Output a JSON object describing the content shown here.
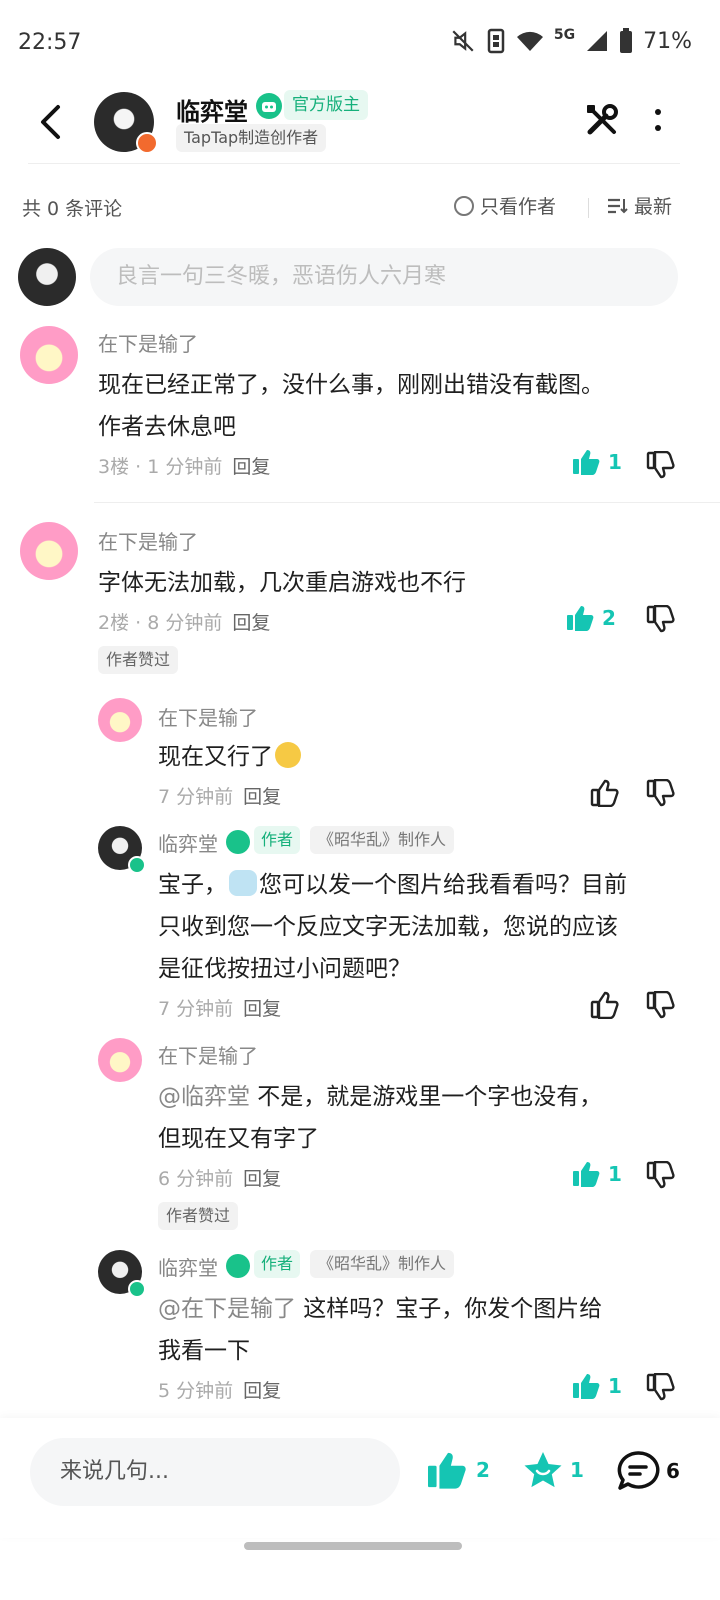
{
  "status_bar": {
    "time": "22:57",
    "network": "5G",
    "battery": "71%"
  },
  "header": {
    "name": "临弈堂",
    "official_tag": "官方版主",
    "creator_tag": "TapTap制造创作者"
  },
  "filter": {
    "comment_count": "共 0 条评论",
    "only_author": "只看作者",
    "sort": "最新"
  },
  "compose": {
    "placeholder": "良言一句三冬暖，恶语伤人六月寒"
  },
  "comments": [
    {
      "name": "在下是输了",
      "text_line1": "现在已经正常了，没什么事，刚刚出错没有截图。",
      "text_line2": "作者去休息吧",
      "meta": "3楼 · 1 分钟前",
      "reply": "回复",
      "likes": "1"
    },
    {
      "name": "在下是输了",
      "text_line1": "字体无法加载，几次重启游戏也不行",
      "meta": "2楼 · 8 分钟前",
      "reply": "回复",
      "likes": "2",
      "tag": "作者赞过"
    }
  ],
  "replies": [
    {
      "name": "在下是输了",
      "text": "现在又行了",
      "meta": "7 分钟前",
      "reply": "回复"
    },
    {
      "name": "临弈堂",
      "author_tag": "作者",
      "maker_tag": "《昭华乱》制作人",
      "text_line1a": "宝子，",
      "text_line1b": "您可以发一个图片给我看看吗？目前",
      "text_line2": "只收到您一个反应文字无法加载，您说的应该",
      "text_line3": "是征伐按扭过小问题吧？",
      "meta": "7 分钟前",
      "reply": "回复"
    },
    {
      "name": "在下是输了",
      "mention": "@临弈堂",
      "text_line1": " 不是，就是游戏里一个字也没有，",
      "text_line2": "但现在又有字了",
      "meta": "6 分钟前",
      "reply": "回复",
      "likes": "1",
      "tag": "作者赞过"
    },
    {
      "name": "临弈堂",
      "author_tag": "作者",
      "maker_tag": "《昭华乱》制作人",
      "mention": "@在下是输了",
      "text_line1": " 这样吗？宝子，你发个图片给",
      "text_line2": "我看一下",
      "meta": "5 分钟前",
      "reply": "回复",
      "likes": "1"
    }
  ],
  "bottom_bar": {
    "placeholder": "来说几句...",
    "likes": "2",
    "favorites": "1",
    "comments": "6"
  },
  "colors": {
    "accent": "#15c5b3",
    "verified": "#19c28a",
    "tag_bg": "#e7f8f1"
  }
}
